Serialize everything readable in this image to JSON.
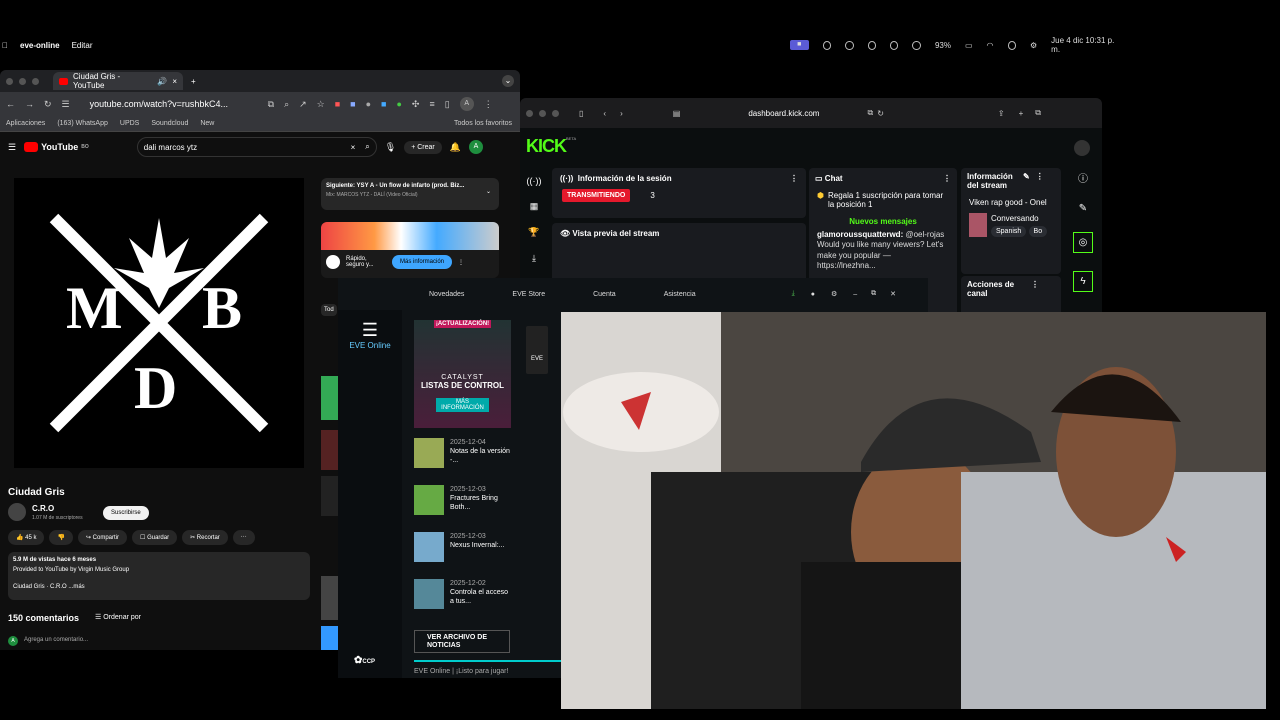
{
  "menubar": {
    "app_name": "eve-online",
    "menu_edit": "Editar",
    "battery": "93%",
    "clock": "Jue 4 dic  10:31 p. m."
  },
  "chrome": {
    "tab_title": "Ciudad Gris - YouTube",
    "url": "youtube.com/watch?v=rushbkC4...",
    "bookmarks": [
      "Aplicaciones",
      "(163) WhatsApp",
      "UPDS",
      "Soundcloud",
      "New"
    ],
    "all_bookmarks": "Todos los favoritos"
  },
  "youtube": {
    "logo": "YouTube",
    "country_code": "BO",
    "search_query": "dali marcos ytz",
    "create_label": "Crear",
    "avatar_letter": "A",
    "video_title": "Ciudad Gris",
    "channel_name": "C.R.O",
    "subscribers": "1.07 M de suscriptores",
    "subscribe_label": "Suscribirse",
    "likes": "45 k",
    "share_label": "Compartir",
    "save_label": "Guardar",
    "clip_label": "Recortar",
    "desc_views": "5.9 M de vistas  hace 6 meses",
    "desc_provided": "Provided to YouTube by Virgin Music Group",
    "desc_line": "Ciudad Gris · C.R.O  ...más",
    "comments_count": "150 comentarios",
    "sort_label": "Ordenar por",
    "add_comment": "Agrega un comentario...",
    "next_title": "Siguiente: YSY A - Un flow de infarto (prod. Biz...",
    "next_sub": "Mix: MARCOS YTZ - DALÍ (Video Oficial)",
    "ad_text": "Rápido, seguro y...",
    "ad_button": "Más información",
    "chip_all": "Tod"
  },
  "kick": {
    "url": "dashboard.kick.com",
    "logo": "KICK",
    "beta": "BETA",
    "session_title": "Información de la sesión",
    "live_badge": "TRANSMITIENDO",
    "viewers": "3",
    "preview_title": "Vista previa del stream",
    "chat_title": "Chat",
    "gift_text": "Regala 1 suscripción para tomar la posición 1",
    "new_messages": "Nuevos mensajes",
    "chat_user": "glamoroussquatterwd:",
    "chat_mention": "@oel-rojas",
    "chat_msg": "Would you like many viewers? Let's make you popular — https://lnezhna...",
    "stream_info_title": "Información del stream",
    "stream_name": "Viken rap good - Onel",
    "category": "Conversando",
    "tags": [
      "Spanish",
      "Bo"
    ],
    "channel_actions": "Acciones de canal"
  },
  "eve": {
    "nav": [
      "Novedades",
      "EVE Store",
      "Cuenta",
      "Asistencia"
    ],
    "side_label": "EVE Online",
    "banner_tag": "¡ACTUALIZACIÓN!",
    "banner_title": "CATALYST",
    "banner_sub": "LISTAS DE CONTROL",
    "banner_btn": "MÁS INFORMACIÓN",
    "news": [
      {
        "date": "2025-12-04",
        "title": "Notas de la versión -..."
      },
      {
        "date": "2025-12-03",
        "title": "Fractures Bring Both..."
      },
      {
        "date": "2025-12-03",
        "title": "Nexus Invernal:..."
      },
      {
        "date": "2025-12-02",
        "title": "Controla el acceso a tus..."
      }
    ],
    "archive_btn": "VER ARCHIVO DE NOTICIAS",
    "footer_text": "EVE Online | ¡Listo para jugar!",
    "brand": "CCP",
    "eve_tile": "EVE"
  },
  "colors": {
    "kick_green": "#53fc18",
    "yt_red": "#ff0000",
    "live_red": "#e5192c"
  }
}
